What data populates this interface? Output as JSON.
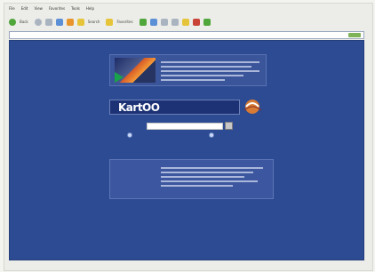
{
  "browser": {
    "menu_items": [
      "File",
      "Edit",
      "View",
      "Favorites",
      "Tools",
      "Help"
    ],
    "toolbar": {
      "back_label": "Back",
      "search_label": "Search",
      "favorites_label": "Favorites"
    },
    "address": {
      "value": "",
      "go_label": ""
    }
  },
  "page": {
    "logo": "KartOO",
    "search_placeholder": "",
    "search_label": "",
    "option1": "",
    "option2": "",
    "help_link": "",
    "bottom_promo_red": [
      "",
      "",
      ""
    ],
    "footer_links": [],
    "footer_line": "",
    "footer_bottom": ""
  },
  "status": {
    "right": ""
  }
}
